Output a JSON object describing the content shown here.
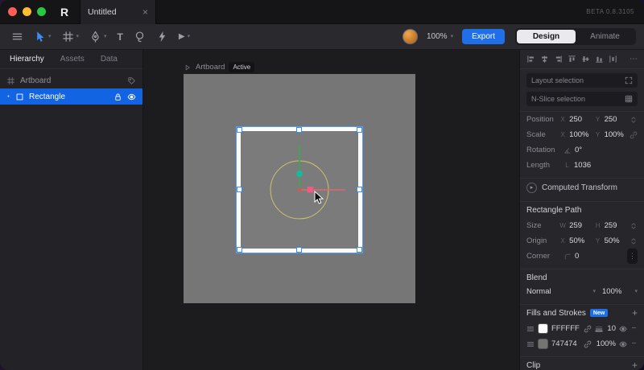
{
  "titlebar": {
    "logo": "R",
    "tab_title": "Untitled",
    "beta_label": "BETA 0.8.3105"
  },
  "toolbar": {
    "zoom_value": "100%",
    "export_label": "Export",
    "design_label": "Design",
    "animate_label": "Animate",
    "text_tool_glyph": "T"
  },
  "sidebar": {
    "tabs": [
      {
        "label": "Hierarchy"
      },
      {
        "label": "Assets"
      },
      {
        "label": "Data"
      }
    ],
    "artboard_item_label": "Artboard",
    "rectangle_item_label": "Rectangle"
  },
  "canvas": {
    "artboard_label": "Artboard",
    "active_badge": "Active"
  },
  "inspector": {
    "layout_selection_label": "Layout selection",
    "nslice_selection_label": "N-Slice selection",
    "rows": {
      "position": {
        "label": "Position",
        "x_key": "X",
        "x": "250",
        "y_key": "Y",
        "y": "250"
      },
      "scale": {
        "label": "Scale",
        "x_key": "X",
        "x": "100%",
        "y_key": "Y",
        "y": "100%"
      },
      "rotation": {
        "label": "Rotation",
        "value": "0°"
      },
      "length": {
        "label": "Length",
        "key": "L",
        "value": "1036"
      },
      "size": {
        "label": "Size",
        "w_key": "W",
        "w": "259",
        "h_key": "H",
        "h": "259"
      },
      "origin": {
        "label": "Origin",
        "x_key": "X",
        "x": "50%",
        "y_key": "Y",
        "y": "50%"
      },
      "corner": {
        "label": "Corner",
        "value": "0"
      }
    },
    "computed_transform_label": "Computed Transform",
    "rectangle_path_title": "Rectangle Path",
    "blend": {
      "title": "Blend",
      "mode": "Normal",
      "opacity": "100%"
    },
    "fills": {
      "title": "Fills and Strokes",
      "new_badge": "New",
      "rows": [
        {
          "hex": "FFFFFF",
          "swatch": "#FFFFFF",
          "value": "10"
        },
        {
          "hex": "747474",
          "swatch": "#747474",
          "value": "100%"
        }
      ]
    },
    "clip_title": "Clip"
  },
  "glyphs": {
    "close": "×",
    "chevron_down": "▾",
    "play": "▶",
    "bullet": "•",
    "plus": "+",
    "minus": "−",
    "ellipsis": "⋯",
    "dots": "⋮",
    "disclosure": "▸"
  },
  "colors": {
    "accent_blue": "#1e6fe8",
    "selection_blue": "#1264e3",
    "artboard_gray": "#767676",
    "gizmo_green": "#3aa94f",
    "gizmo_red": "#e06a6a",
    "gizmo_teal": "#17b89c",
    "gizmo_pink": "#ef5b82",
    "gizmo_ring_yellow": "#cfc06a"
  }
}
